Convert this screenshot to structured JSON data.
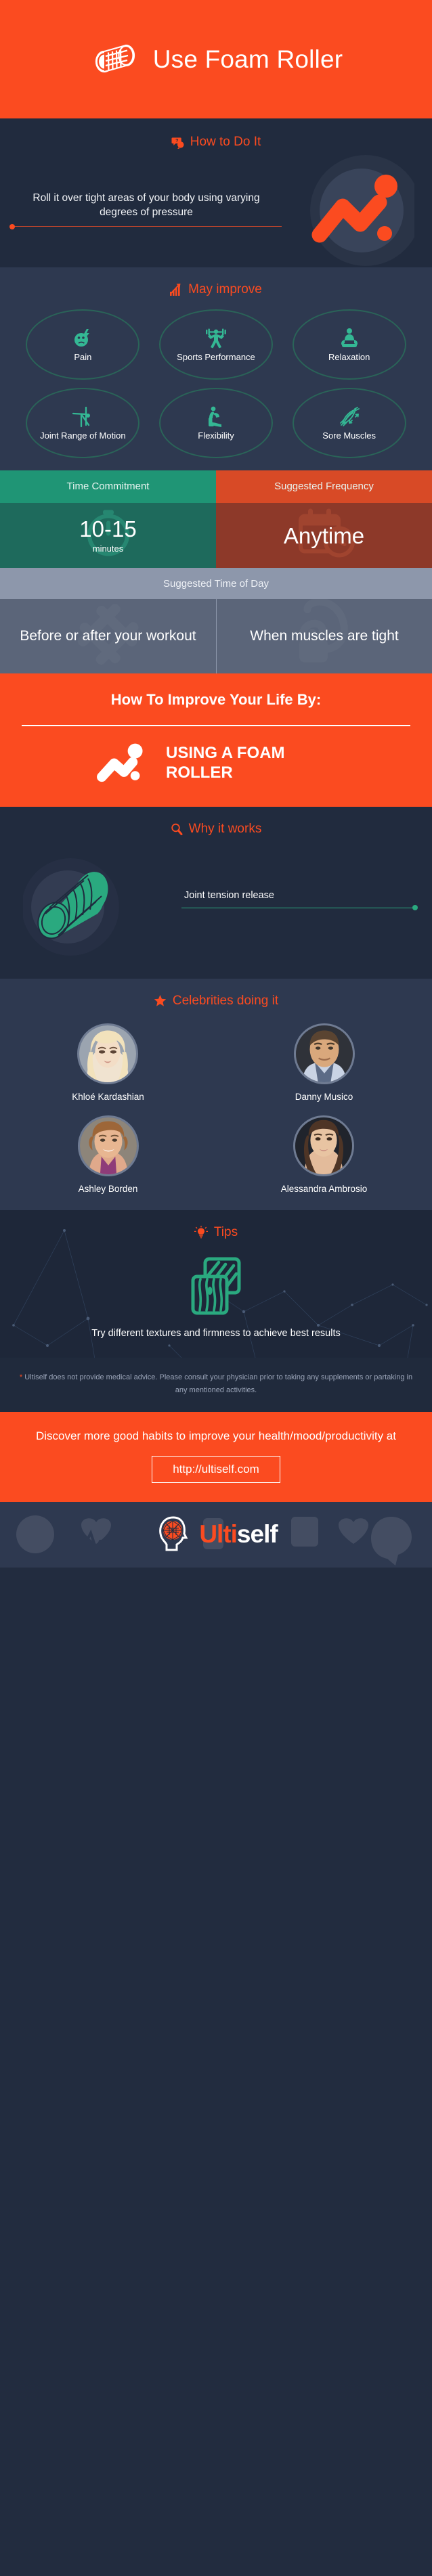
{
  "colors": {
    "orange": "#fb4b20",
    "dark_navy": "#212b3e",
    "mid_navy": "#2e3950",
    "teal": "#1f9575",
    "teal_dark": "#1e6a5c",
    "red": "#d84a26",
    "red_dark": "#8d3929",
    "slate": "#5b6579",
    "slate_light": "#8d97ab",
    "green_accent": "#2aa97f",
    "circle_stroke": "#2a6458"
  },
  "header": {
    "title": "Use Foam Roller",
    "icon": "foam-roller-icon"
  },
  "how_to": {
    "heading": "How to Do It",
    "heading_icon": "question-bubble-icon",
    "text": "Roll it over tight areas of your body using varying degrees of pressure",
    "decor_icon": "zigzag-chart-icon"
  },
  "may_improve": {
    "heading": "May improve",
    "heading_icon": "bar-chart-up-icon",
    "items": [
      {
        "label": "Pain",
        "icon": "pain-face-icon"
      },
      {
        "label": "Sports Performance",
        "icon": "weightlifter-icon"
      },
      {
        "label": "Relaxation",
        "icon": "meditation-icon"
      },
      {
        "label": "Joint Range of Motion",
        "icon": "stretching-person-icon"
      },
      {
        "label": "Flexibility",
        "icon": "lunge-stretch-icon"
      },
      {
        "label": "Sore Muscles",
        "icon": "muscle-fiber-icon"
      }
    ]
  },
  "time_frequency": {
    "time_commitment": {
      "header": "Time Commitment",
      "value": "10-15",
      "unit": "minutes",
      "bg_icon": "clock-icon"
    },
    "suggested_frequency": {
      "header": "Suggested Frequency",
      "value": "Anytime",
      "bg_icon": "calendar-clock-icon"
    }
  },
  "time_of_day": {
    "heading": "Suggested Time of Day",
    "items": [
      {
        "label": "Before or after your workout",
        "bg_icon": "dumbbell-icon"
      },
      {
        "label": "When muscles are tight",
        "bg_icon": "flexed-arm-icon"
      }
    ]
  },
  "banner": {
    "title": "How To Improve Your Life By:",
    "subtitle": "USING A FOAM ROLLER",
    "icon": "zigzag-chart-icon"
  },
  "why_it_works": {
    "heading": "Why it works",
    "heading_icon": "magnifier-icon",
    "label": "Joint tension release",
    "icon": "foam-roller-icon"
  },
  "celebrities": {
    "heading": "Celebrities doing it",
    "heading_icon": "star-icon",
    "people": [
      {
        "name": "Khloé Kardashian",
        "avatar": "portrait-blonde-woman"
      },
      {
        "name": "Danny Musico",
        "avatar": "portrait-man-short-hair"
      },
      {
        "name": "Ashley Borden",
        "avatar": "portrait-woman-brown-hair"
      },
      {
        "name": "Alessandra Ambrosio",
        "avatar": "portrait-brunette-woman"
      }
    ]
  },
  "tips": {
    "heading": "Tips",
    "heading_icon": "lightbulb-icon",
    "icon": "texture-tiles-icon",
    "text": "Try different textures and firmness to achieve best results"
  },
  "disclaimer": {
    "star": "*",
    "text": "Ultiself does not provide medical advice. Please consult your physician prior to taking any supplements or partaking in any mentioned activities."
  },
  "cta": {
    "text": "Discover more good habits to improve your health/mood/productivity at",
    "url": "http://ultiself.com"
  },
  "footer": {
    "brand_first": "Ulti",
    "brand_second": "self",
    "logo_icon": "brain-head-icon"
  }
}
